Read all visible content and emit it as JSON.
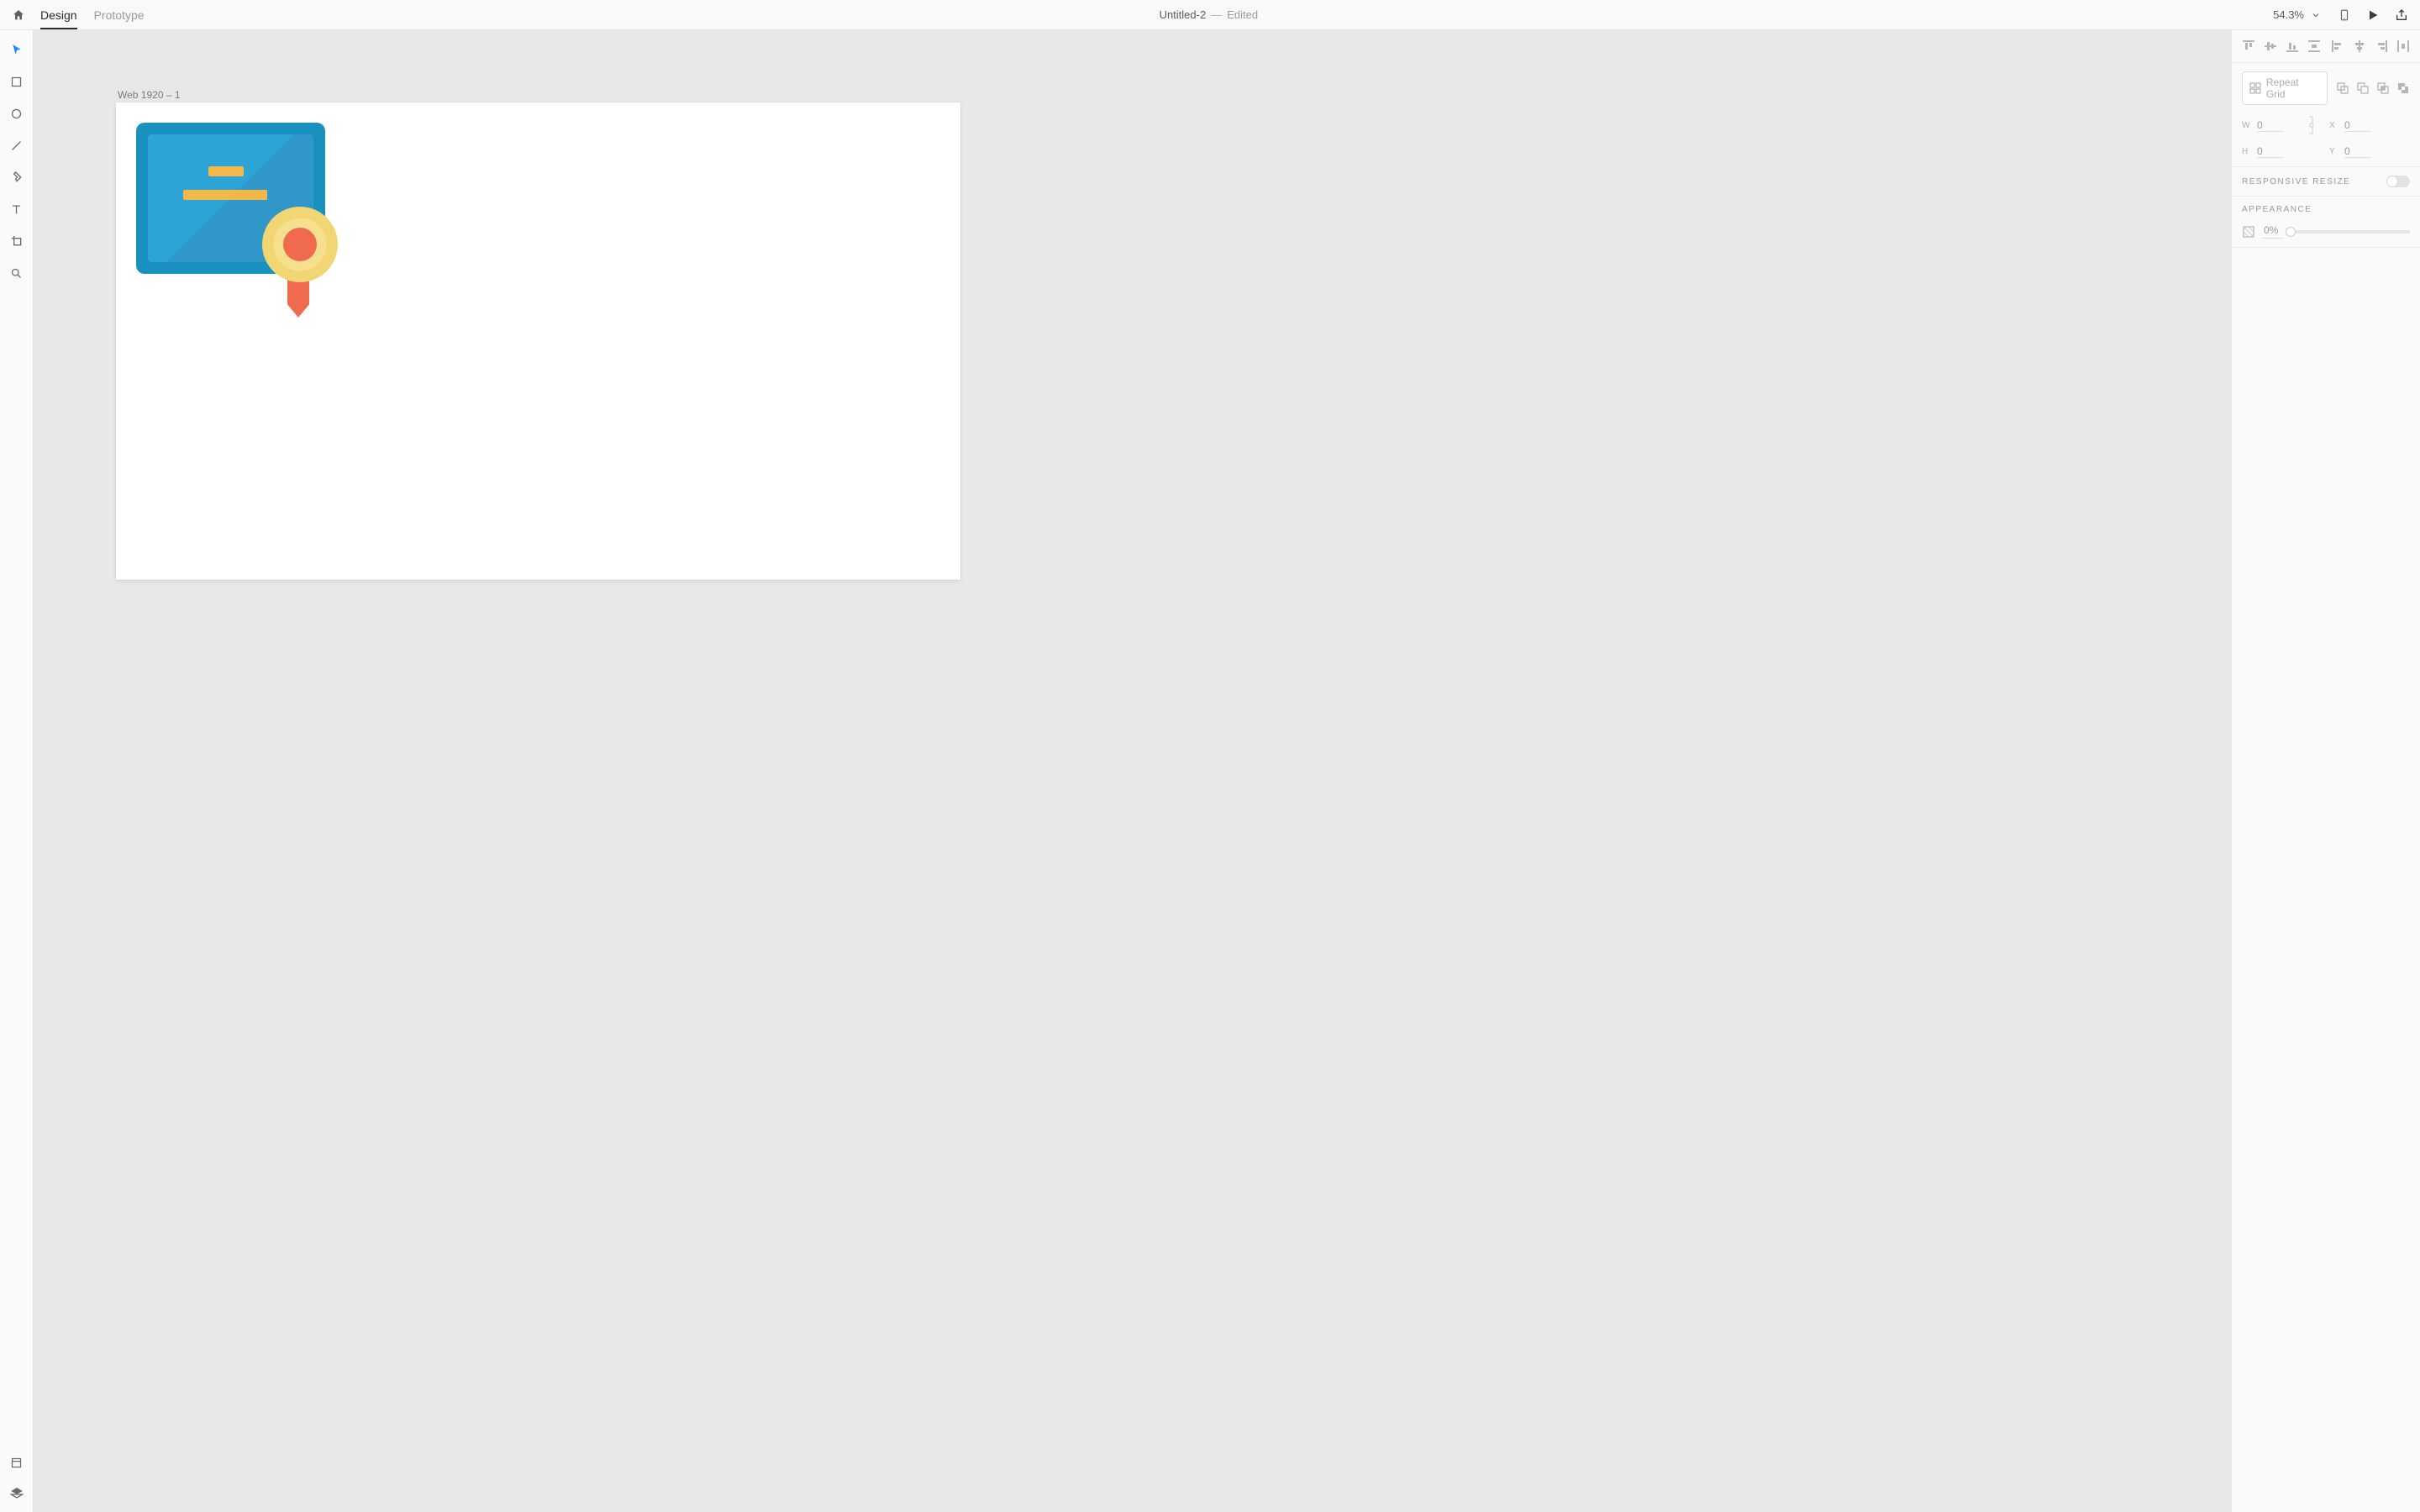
{
  "header": {
    "tabs": {
      "design": "Design",
      "prototype": "Prototype"
    },
    "doc_title": "Untitled-2",
    "edited_label": "Edited",
    "zoom": "54.3%"
  },
  "canvas": {
    "artboard_label": "Web 1920 – 1"
  },
  "inspector": {
    "repeat_grid_label": "Repeat Grid",
    "dims": {
      "w": "0",
      "h": "0",
      "x": "0",
      "y": "0"
    },
    "responsive_resize_label": "RESPONSIVE RESIZE",
    "appearance_label": "APPEARANCE",
    "opacity": "0%"
  }
}
